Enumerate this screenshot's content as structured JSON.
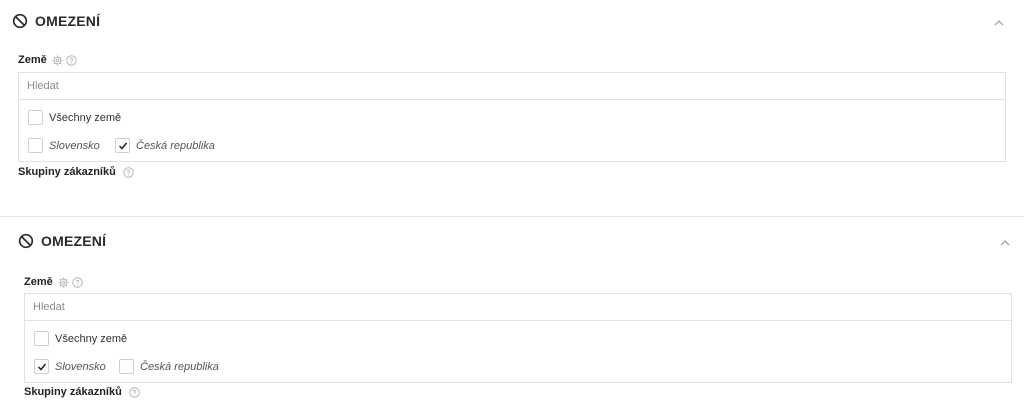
{
  "sections": [
    {
      "title": "OMEZENÍ",
      "country_label": "Země",
      "search_placeholder": "Hledat",
      "all_countries_label": "Všechny země",
      "countries": [
        {
          "label": "Slovensko",
          "checked": false
        },
        {
          "label": "Česká republika",
          "checked": true
        }
      ],
      "groups_label": "Skupiny zákazníků"
    },
    {
      "title": "OMEZENÍ",
      "country_label": "Země",
      "search_placeholder": "Hledat",
      "all_countries_label": "Všechny země",
      "countries": [
        {
          "label": "Slovensko",
          "checked": true
        },
        {
          "label": "Česká republika",
          "checked": false
        }
      ],
      "groups_label": "Skupiny zákazníků"
    }
  ],
  "icons": {
    "section": "ban-icon",
    "collapse": "chevron-up-icon",
    "settings": "gear-icon",
    "help": "help-icon"
  },
  "colors": {
    "text": "#2b2b2b",
    "border": "#e2e2e2",
    "muted": "#8a8a8a"
  }
}
